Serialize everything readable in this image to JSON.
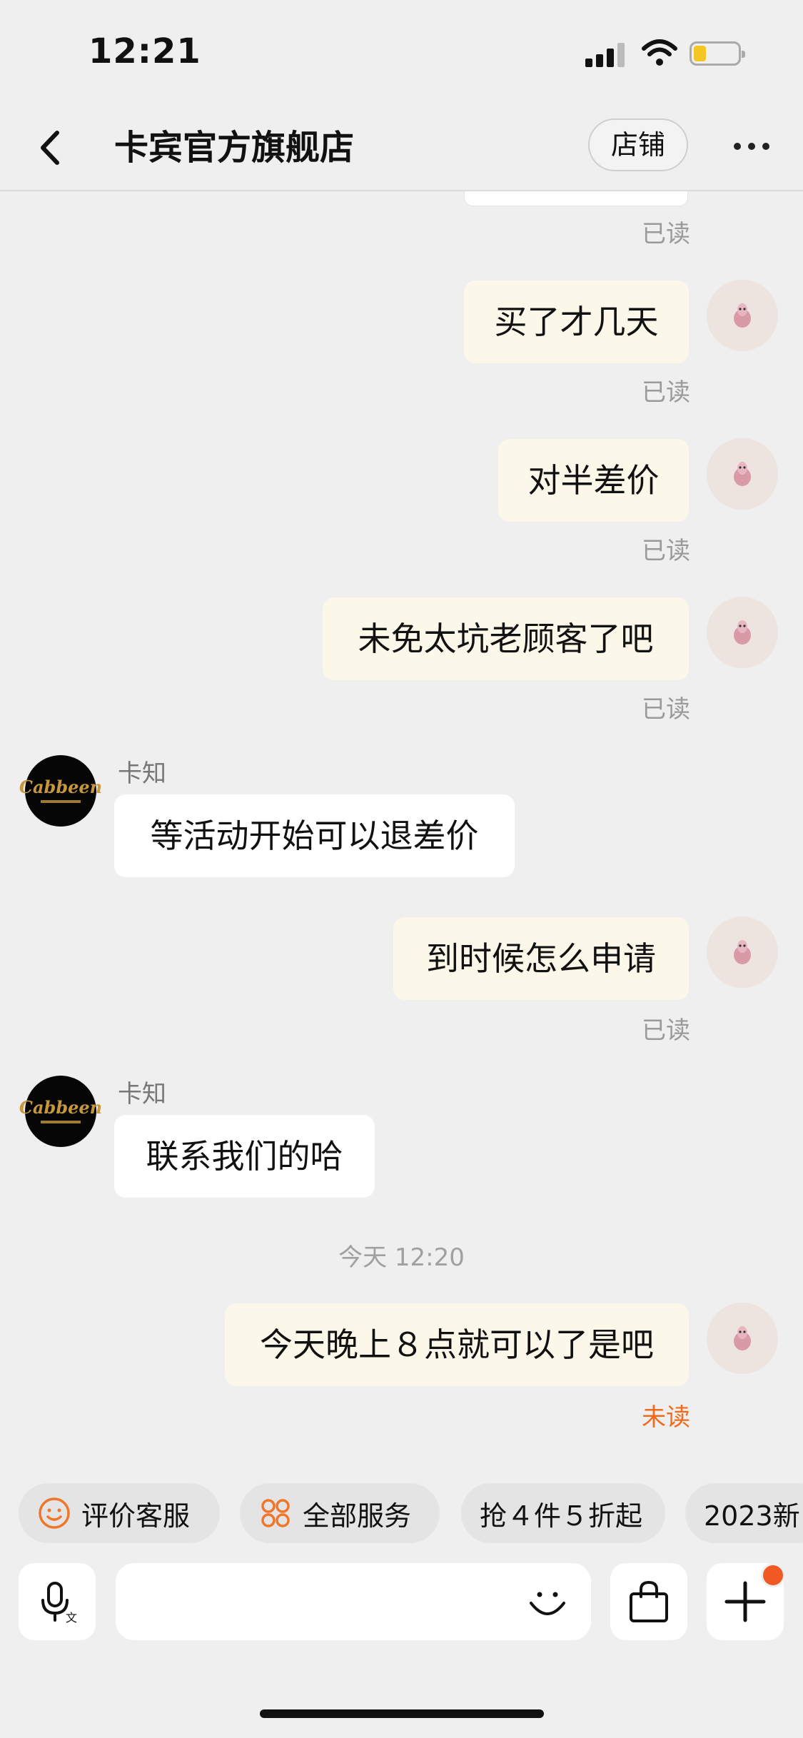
{
  "status_bar": {
    "time": "12:21",
    "battery_level": 0.25
  },
  "header": {
    "title": "卡宾官方旗舰店",
    "shop_button": "店铺"
  },
  "messages": {
    "m0": {
      "read": "已读"
    },
    "m1": {
      "text": "买了才几天",
      "read": "已读"
    },
    "m2": {
      "text": "对半差价",
      "read": "已读"
    },
    "m3": {
      "text": "未免太坑老顾客了吧",
      "read": "已读"
    },
    "m4": {
      "sender": "卡知",
      "text": "等活动开始可以退差价"
    },
    "m5": {
      "text": "到时候怎么申请",
      "read": "已读"
    },
    "m6": {
      "sender": "卡知",
      "text": "联系我们的哈"
    },
    "time_divider": "今天 12:20",
    "m7": {
      "text": "今天晚上８点就可以了是吧",
      "read": "未读"
    }
  },
  "shop_avatar": {
    "brand": "Cabbeen"
  },
  "quick_actions": [
    {
      "label": "评价客服",
      "icon": "smile-icon"
    },
    {
      "label": "全部服务",
      "icon": "grid-icon"
    },
    {
      "label": "抢４件５折起"
    },
    {
      "label": "2023新"
    }
  ],
  "input": {
    "placeholder": ""
  },
  "colors": {
    "accent": "#f26a1b",
    "outgoing_bubble": "#fbf8ea",
    "incoming_bubble": "#ffffff",
    "background": "#efefef"
  }
}
